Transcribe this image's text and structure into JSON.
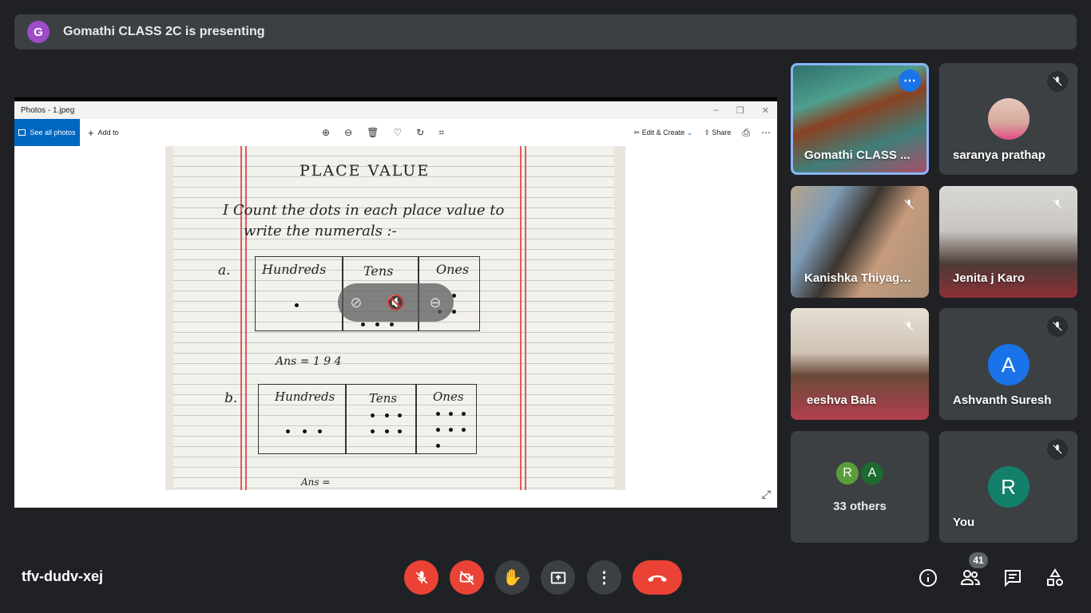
{
  "banner": {
    "avatar_letter": "G",
    "text": "Gomathi CLASS 2C is presenting",
    "avatar_color": "#9c4cc6"
  },
  "photos_app": {
    "window_title": "Photos - 1.jpeg",
    "see_all_label": "See all photos",
    "add_to_label": "Add to",
    "edit_create_label": "Edit & Create",
    "share_label": "Share",
    "worksheet": {
      "title": "PLACE VALUE",
      "instruction_line1": "I  Count  the  dots  in  each  place value  to",
      "instruction_line2": "write  the  numerals :-",
      "label_a": "a.",
      "label_b": "b.",
      "col_hundreds": "Hundreds",
      "col_tens": "Tens",
      "col_ones": "Ones",
      "answer_a": "Ans = 1 9 4",
      "answer_b": "Ans ="
    }
  },
  "participants": [
    {
      "name": "Gomathi CLASS ...",
      "type": "video"
    },
    {
      "name": "saranya prathap",
      "type": "photo"
    },
    {
      "name": "Kanishka Thiyaga...",
      "type": "video"
    },
    {
      "name": "Jenita j Karo",
      "type": "video"
    },
    {
      "name": "eeshva Bala",
      "type": "video"
    },
    {
      "name": "Ashvanth Suresh",
      "type": "avatar",
      "letter": "A",
      "color": "#1a73e8"
    },
    {
      "name": "33 others",
      "type": "group",
      "letters": [
        "R",
        "A"
      ]
    },
    {
      "name": "You",
      "type": "avatar",
      "letter": "R",
      "color": "#12806a"
    }
  ],
  "meeting": {
    "code": "tfv-dudv-xej",
    "participant_count": "41"
  },
  "colors": {
    "background": "#202124",
    "tile": "#3c4043",
    "accent": "#1a73e8",
    "danger": "#ea4335"
  }
}
